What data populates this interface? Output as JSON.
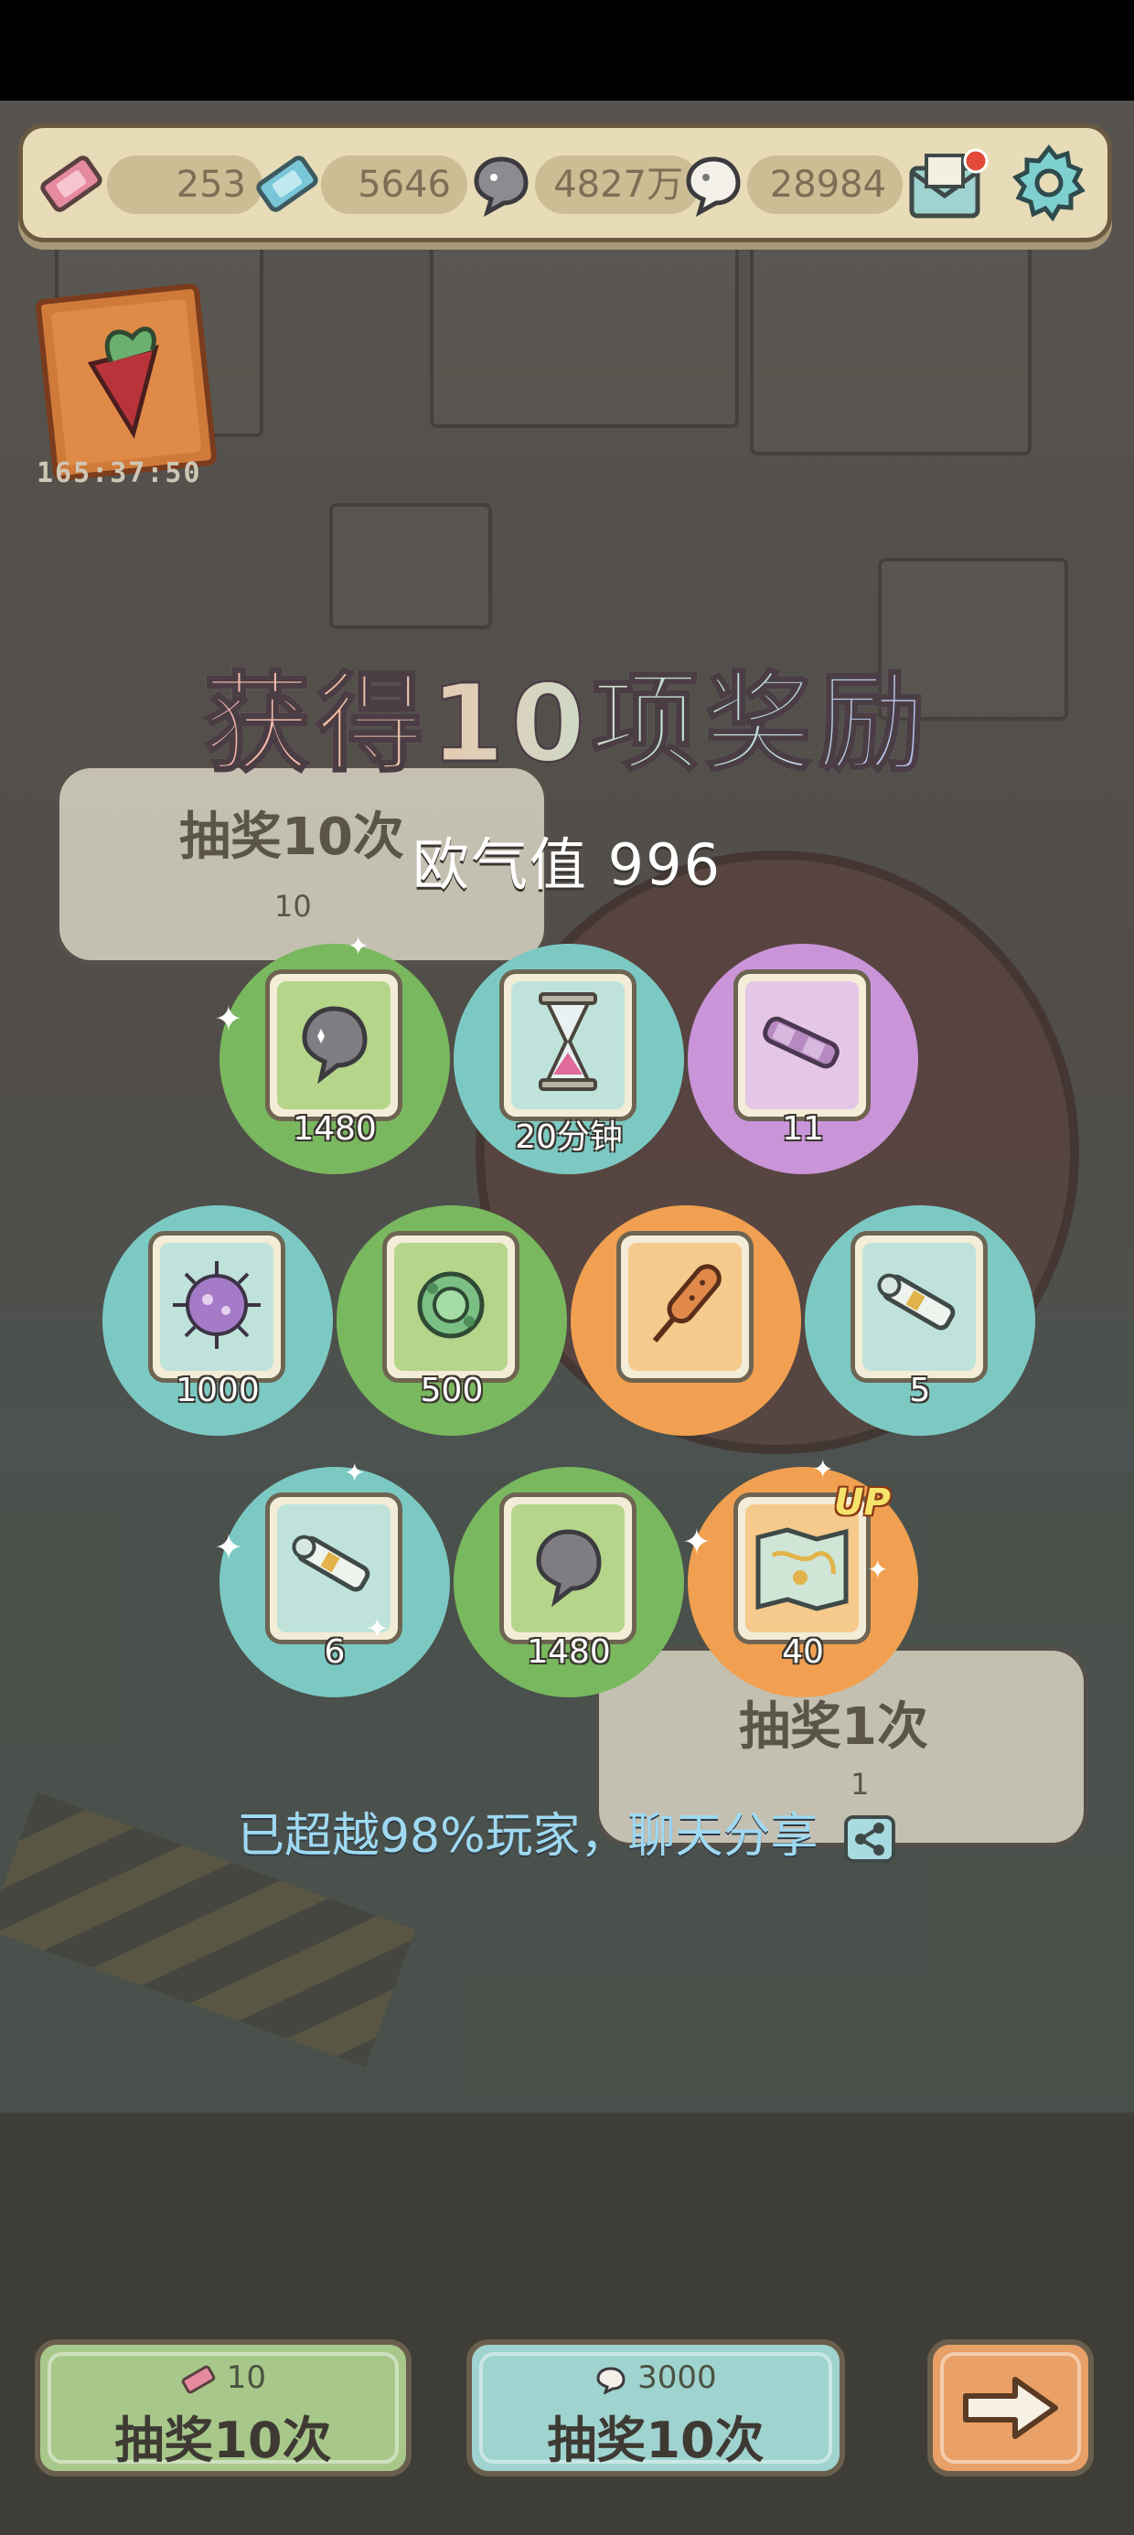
{
  "resources": [
    {
      "icon": "ticket-icon",
      "value": "253"
    },
    {
      "icon": "blue-ticket-icon",
      "value": "5646"
    },
    {
      "icon": "dark-soul-icon",
      "value": "4827万"
    },
    {
      "icon": "light-soul-icon",
      "value": "28984"
    }
  ],
  "event": {
    "timer": "165:37:50"
  },
  "background": {
    "draw10_label": "抽奖10次",
    "draw10_cost": "10",
    "draw1_label": "抽奖1次",
    "draw1_cost": "1"
  },
  "overlay": {
    "title": "获得10项奖励",
    "luck": "欧气值 996",
    "share_text": "已超越98%玩家，聊天分享"
  },
  "rewards": [
    {
      "icon": "soul-icon",
      "qty": "1480",
      "tier": "green"
    },
    {
      "icon": "hourglass-icon",
      "qty": "20分钟",
      "tier": "teal"
    },
    {
      "icon": "scroll-purple-icon",
      "qty": "11",
      "tier": "purple"
    },
    {
      "icon": "purple-blob-icon",
      "qty": "1000",
      "tier": "teal"
    },
    {
      "icon": "green-blob-icon",
      "qty": "500",
      "tier": "green"
    },
    {
      "icon": "corn-dog-icon",
      "qty": "",
      "tier": "orange"
    },
    {
      "icon": "scroll-icon",
      "qty": "5",
      "tier": "teal"
    },
    {
      "icon": "scroll-icon",
      "qty": "6",
      "tier": "teal"
    },
    {
      "icon": "soul-icon",
      "qty": "1480",
      "tier": "green"
    },
    {
      "icon": "map-icon",
      "qty": "40",
      "tier": "orange",
      "badge": "UP"
    }
  ],
  "buttons": {
    "left": {
      "cost": "10",
      "label": "抽奖10次",
      "color": "#a7c88a"
    },
    "mid": {
      "cost": "3000",
      "label": "抽奖10次",
      "color": "#9fd3cf"
    },
    "right": {
      "color": "#e9a066"
    }
  }
}
